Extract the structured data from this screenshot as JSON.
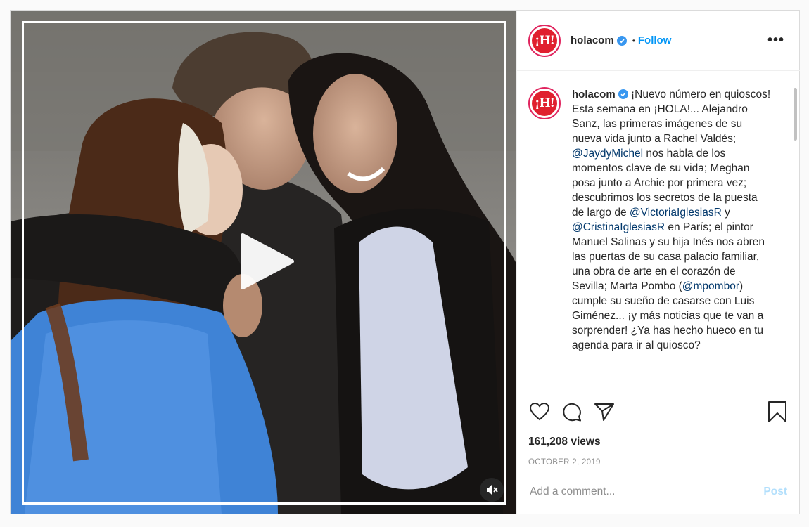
{
  "post": {
    "media_alt": "Video post",
    "play_icon": "play-icon",
    "mute_icon": "mute-icon"
  },
  "header": {
    "avatar_text": "¡H!",
    "username": "holacom",
    "separator": "•",
    "follow_label": "Follow",
    "more_label": "•••"
  },
  "caption": {
    "username": "holacom",
    "segments": [
      {
        "text": "¡Nuevo número en quioscos! Esta semana en ¡HOLA!... Alejandro Sanz, las primeras imágenes de su nueva vida junto a Rachel Valdés; ",
        "mention": false
      },
      {
        "text": "@JaydyMichel",
        "mention": true
      },
      {
        "text": " nos habla de los momentos clave de su vida; Meghan posa junto a Archie por primera vez; descubrimos los secretos de la puesta de largo de ",
        "mention": false
      },
      {
        "text": "@VictoriaIglesiasR",
        "mention": true
      },
      {
        "text": " y ",
        "mention": false
      },
      {
        "text": "@CristinaIglesiasR",
        "mention": true
      },
      {
        "text": " en París; el pintor Manuel Salinas y su hija Inés nos abren las puertas de su casa palacio familiar, una obra de arte en el corazón de Sevilla; Marta Pombo (",
        "mention": false
      },
      {
        "text": "@mpombor",
        "mention": true
      },
      {
        "text": ") cumple su sueño de casarse con Luis Giménez... ¡y más noticias que te van a sorprender! ¿Ya has hecho hueco en tu agenda para ir al quiosco?",
        "mention": false
      }
    ]
  },
  "stats": {
    "views": "161,208 views",
    "date": "OCTOBER 2, 2019"
  },
  "comment": {
    "placeholder": "Add a comment...",
    "post_label": "Post"
  },
  "colors": {
    "accent": "#0095f6",
    "mention": "#00376b",
    "post_disabled": "#b2dffc",
    "brand_red": "#e0202f"
  }
}
